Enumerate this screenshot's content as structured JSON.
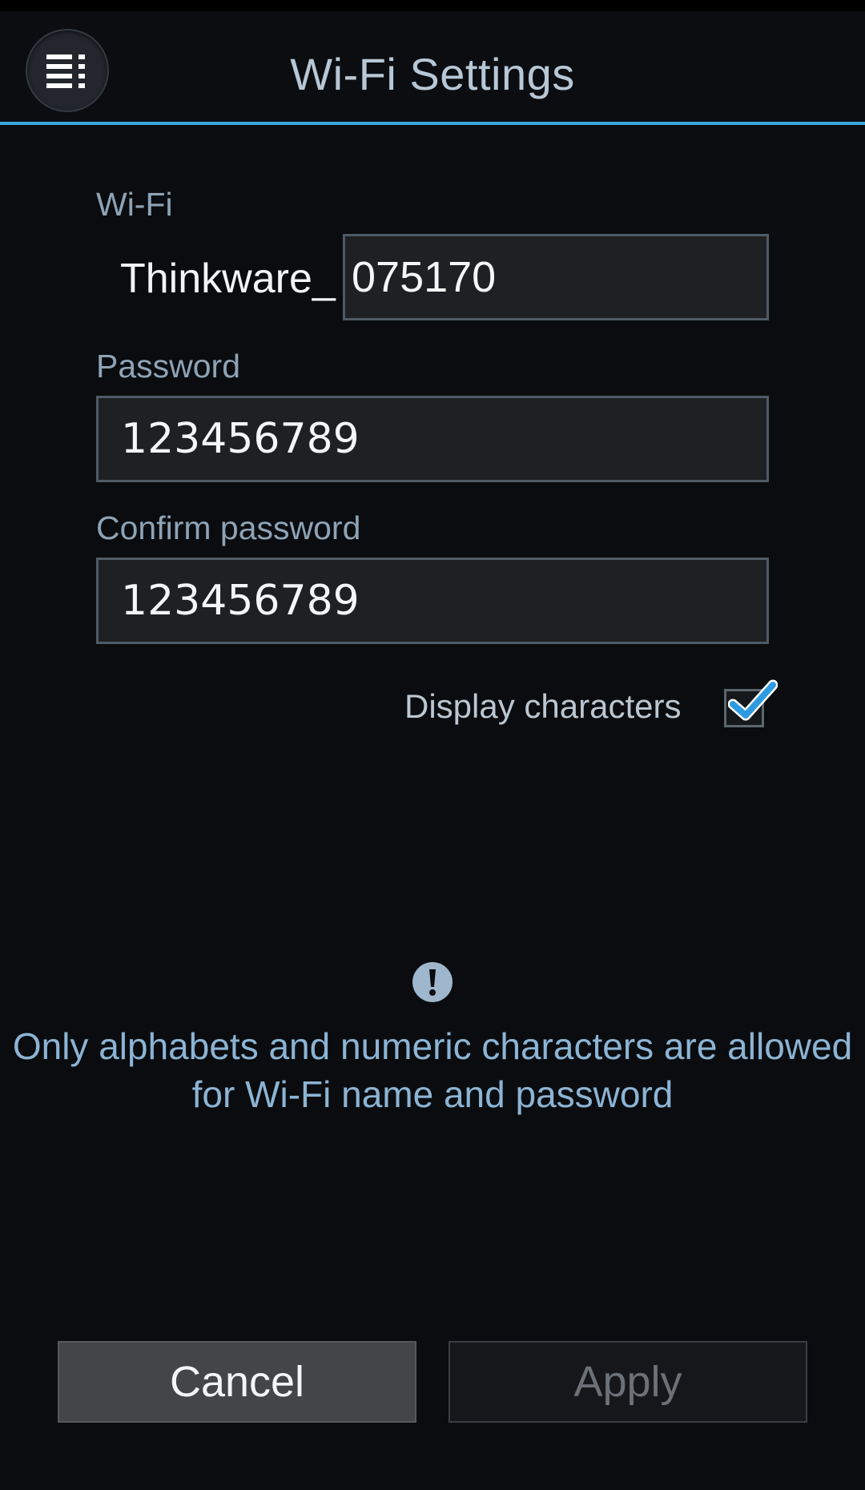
{
  "header": {
    "title": "Wi-Fi Settings",
    "menu_icon": "menu-list-icon"
  },
  "wifi": {
    "label": "Wi-Fi",
    "prefix": "Thinkware_",
    "suffix_value": "075170"
  },
  "password": {
    "label": "Password",
    "value": "123456789"
  },
  "confirm_password": {
    "label": "Confirm password",
    "value": "123456789"
  },
  "display_characters": {
    "label": "Display characters",
    "checked": true
  },
  "notice": {
    "icon": "exclamation-icon",
    "line1": "Only alphabets and numeric characters are allowed",
    "line2": "for Wi-Fi name and password"
  },
  "buttons": {
    "cancel": "Cancel",
    "apply": "Apply"
  },
  "colors": {
    "accent": "#3aa6dc",
    "background": "#0a0c0f",
    "notice_text": "#8cb4d4"
  }
}
